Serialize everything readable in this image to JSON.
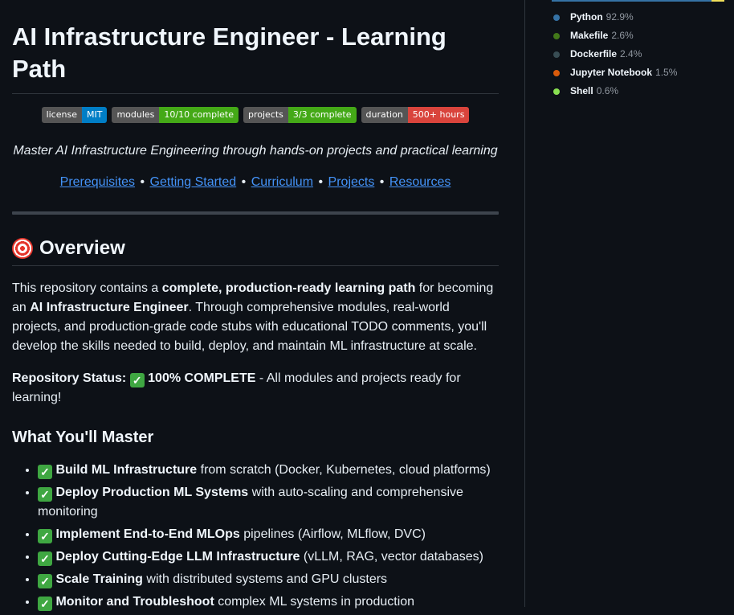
{
  "readme": {
    "title": "AI Infrastructure Engineer - Learning Path",
    "badges": [
      {
        "label": "license",
        "value": "MIT",
        "color": "#007ec6"
      },
      {
        "label": "modules",
        "value": "10/10 complete",
        "color": "#4c1"
      },
      {
        "label": "projects",
        "value": "3/3 complete",
        "color": "#4c1"
      },
      {
        "label": "duration",
        "value": "500+ hours",
        "color": "#e05d44"
      }
    ],
    "tagline": "Master AI Infrastructure Engineering through hands-on projects and practical learning",
    "nav_links": [
      "Prerequisites",
      "Getting Started",
      "Curriculum",
      "Projects",
      "Resources"
    ],
    "nav_separator": "•",
    "overview_heading": "Overview",
    "overview_icon": "direct-hit-icon",
    "overview_para": {
      "p1": "This repository contains a ",
      "b1": "complete, production-ready learning path",
      "p2": " for becoming an ",
      "b2": "AI Infrastructure Engineer",
      "p3": ". Through comprehensive modules, real-world projects, and production-grade code stubs with educational TODO comments, you'll develop the skills needed to build, deploy, and maintain ML infrastructure at scale."
    },
    "status": {
      "label": "Repository Status:",
      "check": "✓",
      "value": "100% COMPLETE",
      "rest": " - All modules and projects ready for learning!"
    },
    "master_heading": "What You'll Master",
    "master_items": [
      {
        "check": "✓",
        "bold": "Build ML Infrastructure",
        "text": " from scratch (Docker, Kubernetes, cloud platforms)"
      },
      {
        "check": "✓",
        "bold": "Deploy Production ML Systems",
        "text": " with auto-scaling and comprehensive monitoring"
      },
      {
        "check": "✓",
        "bold": "Implement End-to-End MLOps",
        "text": " pipelines (Airflow, MLflow, DVC)"
      },
      {
        "check": "✓",
        "bold": "Deploy Cutting-Edge LLM Infrastructure",
        "text": " (vLLM, RAG, vector databases)"
      },
      {
        "check": "✓",
        "bold": "Scale Training",
        "text": " with distributed systems and GPU clusters"
      },
      {
        "check": "✓",
        "bold": "Monitor and Troubleshoot",
        "text": " complex ML systems in production"
      }
    ]
  },
  "languages": [
    {
      "name": "Python",
      "percent": "92.9%",
      "color": "#3572A5"
    },
    {
      "name": "Makefile",
      "percent": "2.6%",
      "color": "#427819"
    },
    {
      "name": "Dockerfile",
      "percent": "2.4%",
      "color": "#384d54"
    },
    {
      "name": "Jupyter Notebook",
      "percent": "1.5%",
      "color": "#DA5B0B"
    },
    {
      "name": "Shell",
      "percent": "0.6%",
      "color": "#89e051"
    }
  ]
}
